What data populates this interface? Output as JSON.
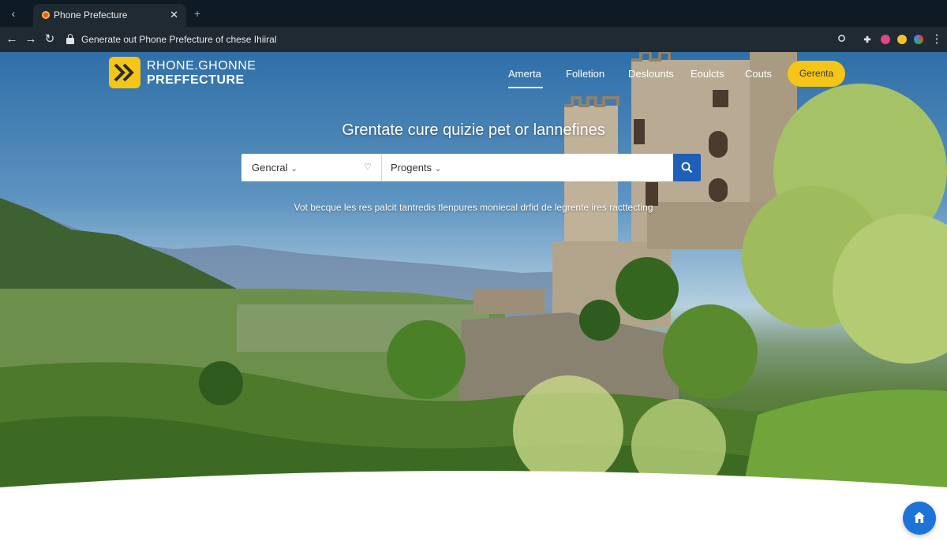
{
  "browser": {
    "tab_title": "Phone Prefecture",
    "tab_close": "✕",
    "new_tab": "+",
    "url": "Generate out Phone Prefecture of chese Ihiiral"
  },
  "brand": {
    "line1": "RHONE.GHONNE",
    "line2": "PREFFECTURE",
    "color": "#f5c518"
  },
  "nav": {
    "items": [
      {
        "label": "Amerta"
      },
      {
        "label": "Folletion"
      },
      {
        "label": "Deslounts"
      },
      {
        "label": "Eoulcts"
      },
      {
        "label": "Couts"
      }
    ],
    "cta_label": "Gerenta"
  },
  "hero": {
    "title": "Grentate cure quizie pet or lannefines",
    "subtitle": "Vot becque les res palcit tantredis tlenpures monieсal drfid de legrente ires racttecting"
  },
  "search": {
    "general_label": "Gencral",
    "projects_label": "Progents",
    "search_icon": "search-icon",
    "button_color": "#1f5fb8"
  },
  "fab": {
    "icon": "home-icon",
    "color": "#1e73d8"
  }
}
